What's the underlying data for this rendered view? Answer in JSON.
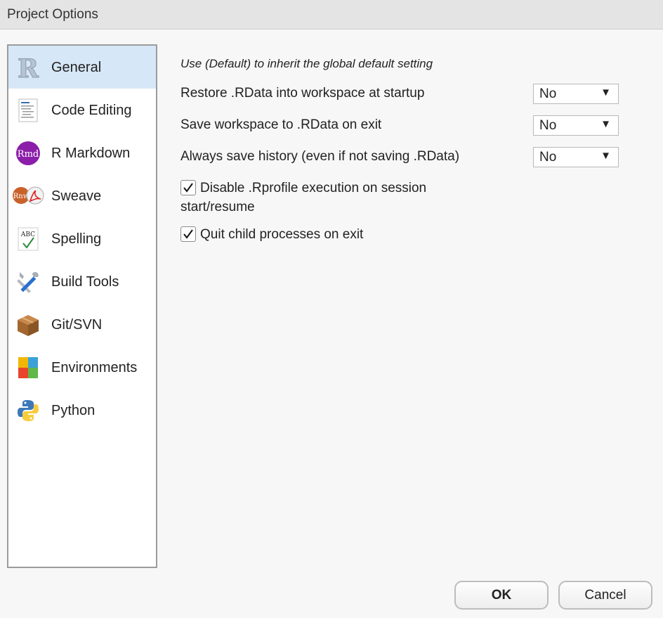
{
  "window": {
    "title": "Project Options"
  },
  "sidebar": {
    "items": [
      {
        "label": "General",
        "icon": "r-logo-icon",
        "selected": true
      },
      {
        "label": "Code Editing",
        "icon": "code-document-icon",
        "selected": false
      },
      {
        "label": "R Markdown",
        "icon": "rmd-icon",
        "selected": false
      },
      {
        "label": "Sweave",
        "icon": "sweave-pdf-icon",
        "selected": false
      },
      {
        "label": "Spelling",
        "icon": "spellcheck-icon",
        "selected": false
      },
      {
        "label": "Build Tools",
        "icon": "tools-icon",
        "selected": false
      },
      {
        "label": "Git/SVN",
        "icon": "package-box-icon",
        "selected": false
      },
      {
        "label": "Environments",
        "icon": "environment-blocks-icon",
        "selected": false
      },
      {
        "label": "Python",
        "icon": "python-icon",
        "selected": false
      }
    ]
  },
  "general": {
    "hint": "Use (Default) to inherit the global default setting",
    "options": [
      {
        "label": "Restore .RData into workspace at startup",
        "value": "No"
      },
      {
        "label": "Save workspace to .RData on exit",
        "value": "No"
      },
      {
        "label": "Always save history (even if not saving .RData)",
        "value": "No"
      }
    ],
    "checks": [
      {
        "label_line1": "Disable .Rprofile execution on session",
        "label_line2": "start/resume",
        "checked": true
      },
      {
        "label_line1": "Quit child processes on exit",
        "checked": true
      }
    ]
  },
  "buttons": {
    "ok": "OK",
    "cancel": "Cancel"
  },
  "colors": {
    "selected_bg": "#d6e7f7",
    "sidebar_border": "#9c9c9c"
  }
}
